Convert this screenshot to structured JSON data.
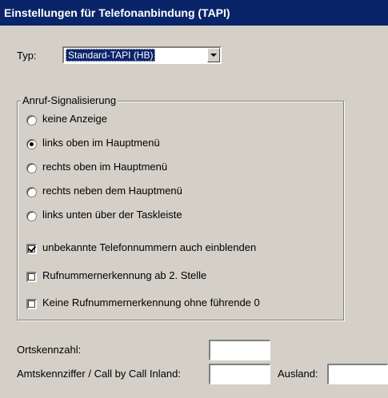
{
  "title": "Einstellungen für Telefonanbindung (TAPI)",
  "typ": {
    "label": "Typ:",
    "selected": "Standard-TAPI (HB)"
  },
  "signal_group": {
    "legend": "Anruf-Signalisierung",
    "radios": [
      {
        "label": "keine Anzeige",
        "checked": false
      },
      {
        "label": "links oben im Hauptmenü",
        "checked": true
      },
      {
        "label": "rechts oben im Hauptmenü",
        "checked": false
      },
      {
        "label": "rechts neben dem Hauptmenü",
        "checked": false
      },
      {
        "label": "links unten über der Taskleiste",
        "checked": false
      }
    ],
    "checkboxes": [
      {
        "label": "unbekannte Telefonnummern auch einblenden",
        "checked": true
      },
      {
        "label": "Rufnummernerkennung ab 2. Stelle",
        "checked": false
      },
      {
        "label": "Keine Rufnummernerkennung ohne führende 0",
        "checked": false
      }
    ]
  },
  "ortskennzahl": {
    "label": "Ortskennzahl:",
    "value": ""
  },
  "amtskennziffer": {
    "label": "Amtskennziffer / Call by Call Inland:",
    "value": ""
  },
  "ausland": {
    "label": "Ausland:",
    "value": ""
  }
}
